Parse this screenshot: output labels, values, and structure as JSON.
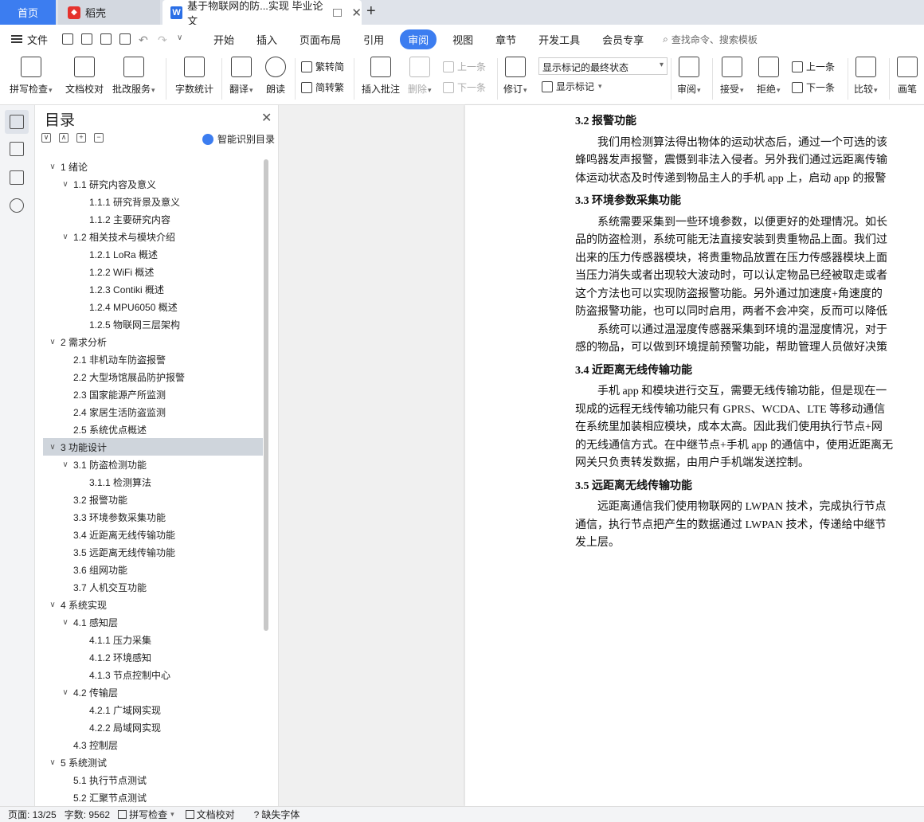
{
  "tabs": {
    "home": "首页",
    "daoke": "稻壳",
    "doc": "基于物联网的防...实现 毕业论文"
  },
  "menubar": {
    "file": "文件",
    "items": [
      "开始",
      "插入",
      "页面布局",
      "引用",
      "审阅",
      "视图",
      "章节",
      "开发工具",
      "会员专享"
    ],
    "active": "审阅",
    "search": "查找命令、搜索模板"
  },
  "ribbon": {
    "spellcheck": "拼写检查",
    "doc_proof": "文档校对",
    "batch_service": "批改服务",
    "word_count": "字数统计",
    "translate": "翻译",
    "read_aloud": "朗读",
    "trad_to_simp": "繁转简",
    "simp_to_trad": "简转繁",
    "insert_comment": "插入批注",
    "delete": "删除",
    "prev_comment": "上一条",
    "next_comment": "下一条",
    "track_changes": "修订",
    "markup_select": "显示标记的最终状态",
    "show_markup": "显示标记",
    "review": "审阅",
    "accept": "接受",
    "reject": "拒绝",
    "prev_change": "上一条",
    "next_change": "下一条",
    "compare": "比较",
    "pen": "画笔"
  },
  "toc": {
    "title": "目录",
    "ai_button": "智能识别目录",
    "items": [
      {
        "text": "1  绪论",
        "level": 1,
        "chev": "∨"
      },
      {
        "text": "1.1  研究内容及意义",
        "level": 2,
        "chev": "∨"
      },
      {
        "text": "1.1.1  研究背景及意义",
        "level": 3,
        "chev": ""
      },
      {
        "text": "1.1.2  主要研究内容",
        "level": 3,
        "chev": ""
      },
      {
        "text": "1.2  相关技术与模块介绍",
        "level": 2,
        "chev": "∨"
      },
      {
        "text": "1.2.1 LoRa 概述",
        "level": 3,
        "chev": ""
      },
      {
        "text": "1.2.2 WiFi 概述",
        "level": 3,
        "chev": ""
      },
      {
        "text": "1.2.3 Contiki 概述",
        "level": 3,
        "chev": ""
      },
      {
        "text": "1.2.4 MPU6050 概述",
        "level": 3,
        "chev": ""
      },
      {
        "text": "1.2.5  物联网三层架构",
        "level": 3,
        "chev": ""
      },
      {
        "text": "2  需求分析",
        "level": 1,
        "chev": "∨"
      },
      {
        "text": "2.1 非机动车防盗报警",
        "level": 2,
        "chev": ""
      },
      {
        "text": "2.2  大型场馆展品防护报警",
        "level": 2,
        "chev": ""
      },
      {
        "text": "2.3  国家能源产所监测",
        "level": 2,
        "chev": ""
      },
      {
        "text": "2.4  家居生活防盗监测",
        "level": 2,
        "chev": ""
      },
      {
        "text": "2.5  系统优点概述",
        "level": 2,
        "chev": ""
      },
      {
        "text": "3  功能设计",
        "level": 1,
        "chev": "∨",
        "selected": true
      },
      {
        "text": "3.1  防盗检测功能",
        "level": 2,
        "chev": "∨"
      },
      {
        "text": "3.1.1  检测算法",
        "level": 3,
        "chev": ""
      },
      {
        "text": "3.2  报警功能",
        "level": 2,
        "chev": ""
      },
      {
        "text": "3.3  环境参数采集功能",
        "level": 2,
        "chev": ""
      },
      {
        "text": "3.4  近距离无线传输功能",
        "level": 2,
        "chev": ""
      },
      {
        "text": "3.5  远距离无线传输功能",
        "level": 2,
        "chev": ""
      },
      {
        "text": "3.6  组网功能",
        "level": 2,
        "chev": ""
      },
      {
        "text": "3.7  人机交互功能",
        "level": 2,
        "chev": ""
      },
      {
        "text": "4  系统实现",
        "level": 1,
        "chev": "∨"
      },
      {
        "text": "4.1  感知层",
        "level": 2,
        "chev": "∨"
      },
      {
        "text": "4.1.1  压力采集",
        "level": 3,
        "chev": ""
      },
      {
        "text": "4.1.2  环境感知",
        "level": 3,
        "chev": ""
      },
      {
        "text": "4.1.3  节点控制中心",
        "level": 3,
        "chev": ""
      },
      {
        "text": "4.2  传输层",
        "level": 2,
        "chev": "∨"
      },
      {
        "text": "4.2.1  广域网实现",
        "level": 3,
        "chev": ""
      },
      {
        "text": "4.2.2  局域网实现",
        "level": 3,
        "chev": ""
      },
      {
        "text": "4.3  控制层",
        "level": 2,
        "chev": ""
      },
      {
        "text": "5  系统测试",
        "level": 1,
        "chev": "∨"
      },
      {
        "text": "5.1  执行节点测试",
        "level": 2,
        "chev": ""
      },
      {
        "text": "5.2  汇聚节点测试",
        "level": 2,
        "chev": ""
      }
    ]
  },
  "document": {
    "blocks": [
      {
        "type": "h",
        "text": "3.2  报警功能"
      },
      {
        "type": "p",
        "text": "我们用检测算法得出物体的运动状态后，通过一个可选的该"
      },
      {
        "type": "c",
        "text": "蜂鸣器发声报警，震慑到非法入侵者。另外我们通过远距离传输"
      },
      {
        "type": "c",
        "text": "体运动状态及时传递到物品主人的手机 app 上，启动 app 的报警"
      },
      {
        "type": "h",
        "text": "3.3  环境参数采集功能"
      },
      {
        "type": "p",
        "text": "系统需要采集到一些环境参数，以便更好的处理情况。如长"
      },
      {
        "type": "c",
        "text": "品的防盗检测，系统可能无法直接安装到贵重物品上面。我们过"
      },
      {
        "type": "c",
        "text": "出来的压力传感器模块，将贵重物品放置在压力传感器模块上面"
      },
      {
        "type": "c",
        "text": "当压力消失或者出现较大波动时，可以认定物品已经被取走或者"
      },
      {
        "type": "c",
        "text": "这个方法也可以实现防盗报警功能。另外通过加速度+角速度的"
      },
      {
        "type": "c",
        "text": "防盗报警功能，也可以同时启用，两者不会冲突，反而可以降低"
      },
      {
        "type": "p",
        "text": "系统可以通过温湿度传感器采集到环境的温湿度情况，对于"
      },
      {
        "type": "c",
        "text": "感的物品，可以做到环境提前预警功能，帮助管理人员做好决策"
      },
      {
        "type": "h",
        "text": "3.4  近距离无线传输功能"
      },
      {
        "type": "p",
        "text": "手机 app 和模块进行交互，需要无线传输功能，但是现在一"
      },
      {
        "type": "c",
        "text": "现成的远程无线传输功能只有 GPRS、WCDA、LTE 等移动通信"
      },
      {
        "type": "c",
        "text": "在系统里加装相应模块，成本太高。因此我们使用执行节点+网"
      },
      {
        "type": "c",
        "text": "的无线通信方式。在中继节点+手机 app 的通信中，使用近距离无"
      },
      {
        "type": "c",
        "text": "网关只负责转发数据，由用户手机端发送控制。"
      },
      {
        "type": "h",
        "text": "3.5  远距离无线传输功能"
      },
      {
        "type": "p",
        "text": "远距离通信我们使用物联网的 LWPAN 技术，完成执行节点"
      },
      {
        "type": "c",
        "text": "通信，执行节点把产生的数据通过 LWPAN 技术，传递给中继节"
      },
      {
        "type": "c",
        "text": "发上层。"
      }
    ]
  },
  "status": {
    "page": "页面: 13/25",
    "words": "字数: 9562",
    "spellcheck": "拼写检查",
    "doc_proof": "文档校对",
    "missing_font": "缺失字体"
  }
}
